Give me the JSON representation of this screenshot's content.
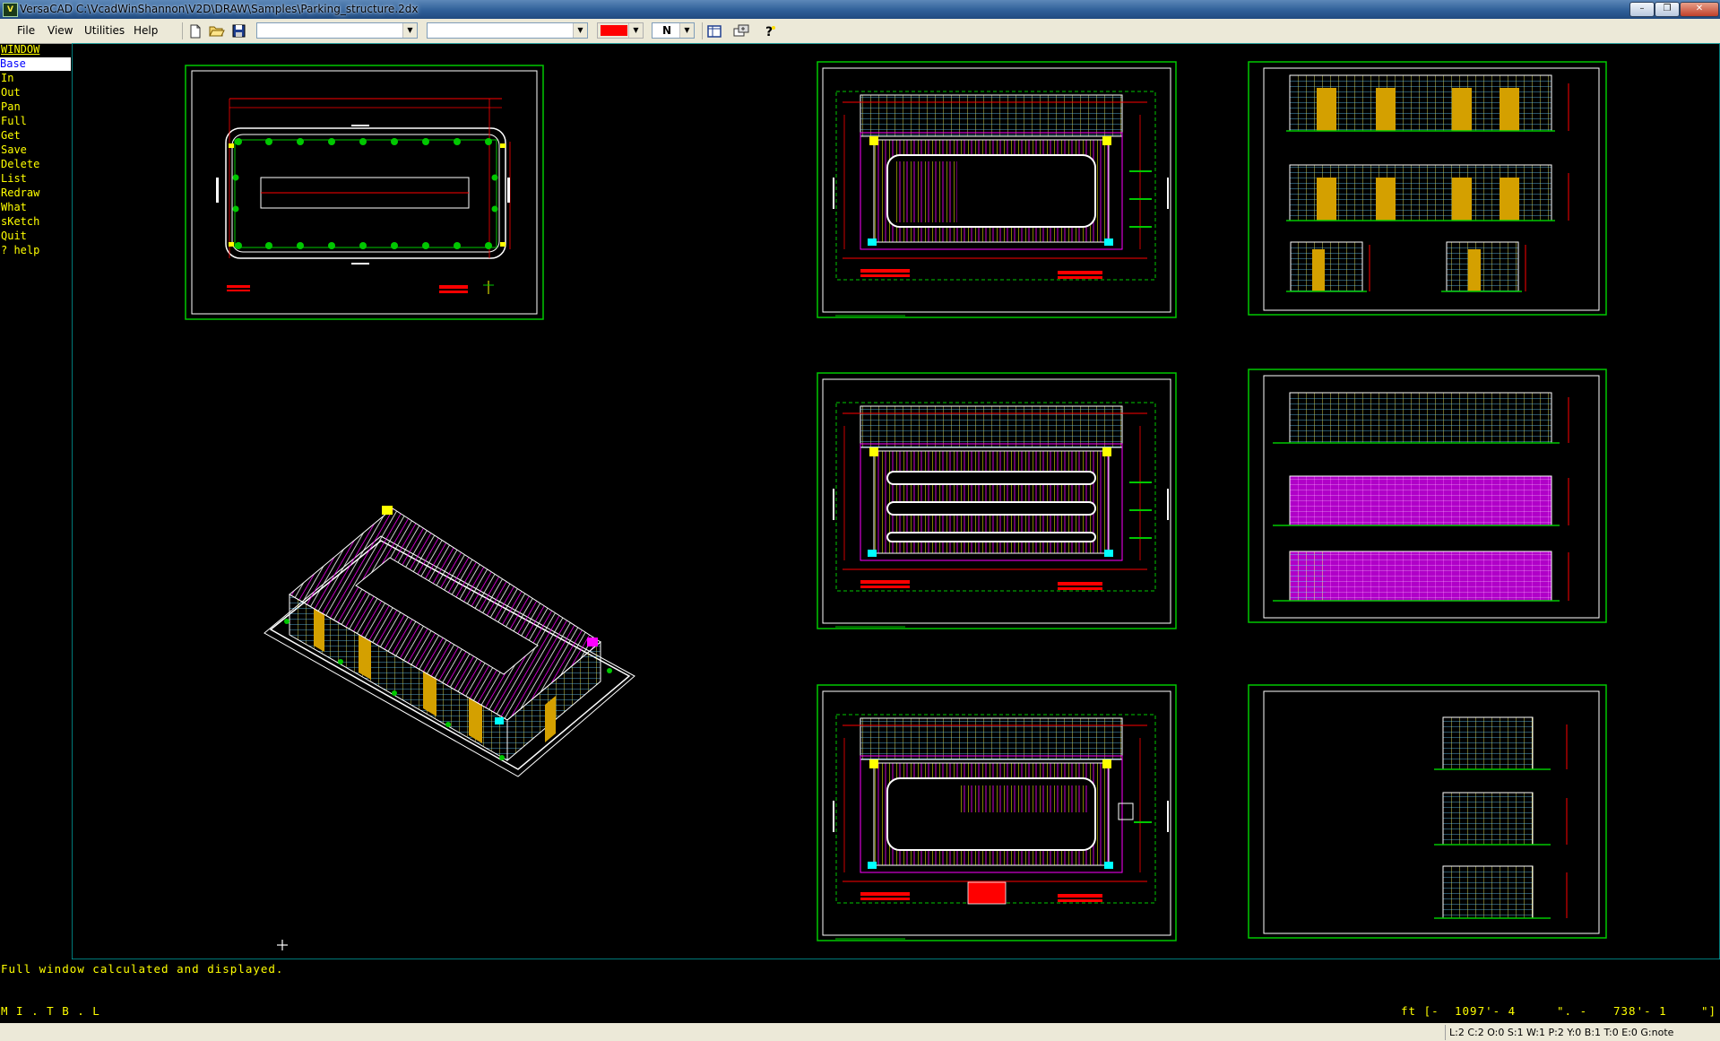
{
  "window": {
    "title": "VersaCAD  C:\\VcadWinShannon\\V2D\\DRAW\\Samples\\Parking_structure.2dx",
    "app_icon_text": "V",
    "minimize": "–",
    "restore": "❐",
    "close": "✕"
  },
  "menus": [
    "File",
    "View",
    "Utilities",
    "Help"
  ],
  "toolbar": {
    "combo1_value": "",
    "combo2_value": "",
    "color": "#ff0000",
    "north_label": "N",
    "icons": [
      "new-file-icon",
      "open-folder-icon",
      "save-icon",
      "layout-icon",
      "settings-icon",
      "help-icon"
    ]
  },
  "side_menu": {
    "header": "WINDOW",
    "items": [
      "Base",
      "In",
      "Out",
      "Pan",
      "Full",
      "Get",
      "Save",
      "Delete",
      "List",
      "Redraw",
      "What",
      "sKetch",
      "Quit",
      "? help"
    ]
  },
  "messages": {
    "prompt": "Full window calculated and displayed.",
    "mode_line": "M I . T B . L",
    "coords_unit": "ft [-",
    "coord_x": "1097'- 4",
    "coord_sep": "\". -",
    "coord_y": "738'- 1",
    "coord_end": "\"]"
  },
  "status": "L:2 C:2 O:0 S:1 W:1 P:2 Y:0 B:1 T:0 E:0 G:note",
  "colors": {
    "sheet_border": "#00c800",
    "sheet_inner": "#ffffff",
    "canvas_frame": "#00a0a0",
    "accent_yellow": "#ffff00",
    "accent_red": "#ff0000",
    "accent_orange": "#d4a000",
    "accent_magenta": "#ff00ff",
    "accent_cyan": "#00ffff"
  }
}
